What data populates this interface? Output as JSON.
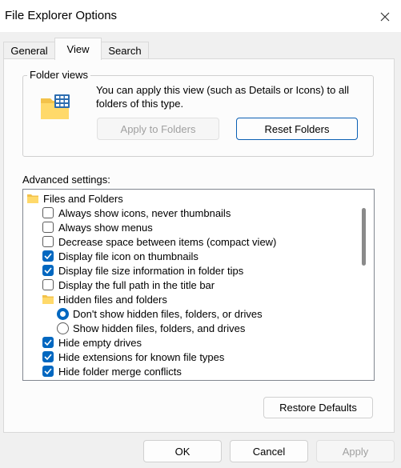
{
  "window": {
    "title": "File Explorer Options",
    "close_icon": "close-icon"
  },
  "tabs": [
    {
      "label": "General",
      "active": false
    },
    {
      "label": "View",
      "active": true
    },
    {
      "label": "Search",
      "active": false
    }
  ],
  "folder_views": {
    "title": "Folder views",
    "description": "You can apply this view (such as Details or Icons) to all folders of this type.",
    "apply_label": "Apply to Folders",
    "reset_label": "Reset Folders"
  },
  "advanced": {
    "label": "Advanced settings:",
    "items": [
      {
        "type": "folder",
        "label": "Files and Folders"
      },
      {
        "type": "checkbox",
        "label": "Always show icons, never thumbnails",
        "checked": false
      },
      {
        "type": "checkbox",
        "label": "Always show menus",
        "checked": false
      },
      {
        "type": "checkbox",
        "label": "Decrease space between items (compact view)",
        "checked": false
      },
      {
        "type": "checkbox",
        "label": "Display file icon on thumbnails",
        "checked": true
      },
      {
        "type": "checkbox",
        "label": "Display file size information in folder tips",
        "checked": true
      },
      {
        "type": "checkbox",
        "label": "Display the full path in the title bar",
        "checked": false
      },
      {
        "type": "folder",
        "label": "Hidden files and folders"
      },
      {
        "type": "radio",
        "label": "Don't show hidden files, folders, or drives",
        "checked": true
      },
      {
        "type": "radio",
        "label": "Show hidden files, folders, and drives",
        "checked": false
      },
      {
        "type": "checkbox",
        "label": "Hide empty drives",
        "checked": true
      },
      {
        "type": "checkbox",
        "label": "Hide extensions for known file types",
        "checked": true
      },
      {
        "type": "checkbox",
        "label": "Hide folder merge conflicts",
        "checked": true
      }
    ],
    "restore_label": "Restore Defaults"
  },
  "footer": {
    "ok_label": "OK",
    "cancel_label": "Cancel",
    "apply_label": "Apply"
  },
  "colors": {
    "accent": "#0067c0",
    "disabled_text": "#a0a0a0"
  }
}
